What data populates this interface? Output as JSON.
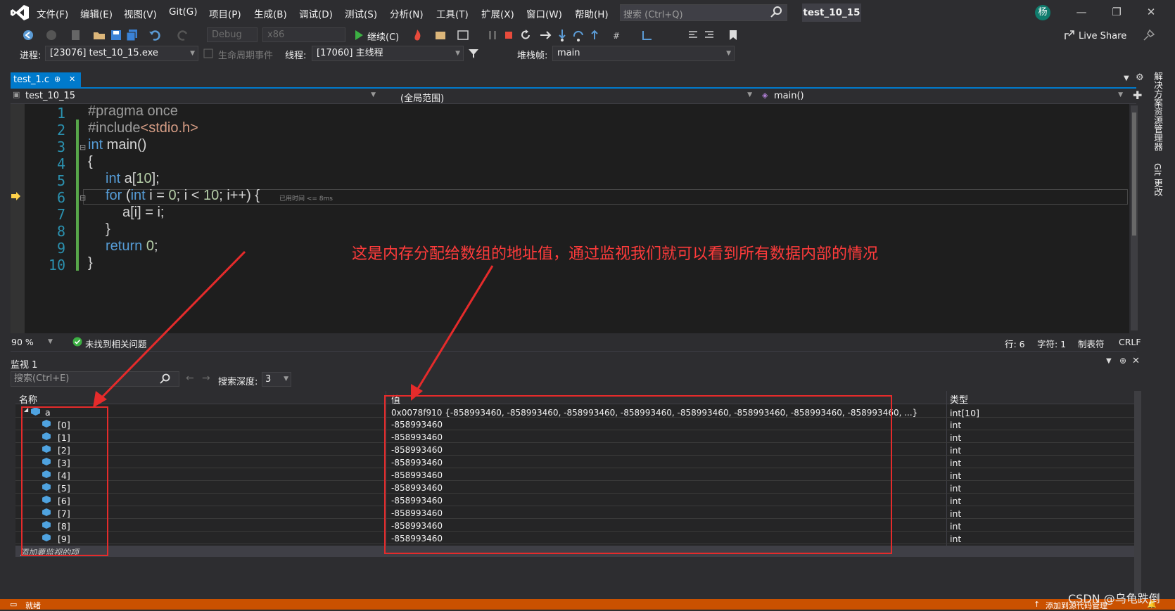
{
  "menu": [
    "文件(F)",
    "编辑(E)",
    "视图(V)",
    "Git(G)",
    "项目(P)",
    "生成(B)",
    "调试(D)",
    "测试(S)",
    "分析(N)",
    "工具(T)",
    "扩展(X)",
    "窗口(W)",
    "帮助(H)"
  ],
  "search_placeholder": "搜索 (Ctrl+Q)",
  "solution_title": "test_10_15",
  "avatar_initial": "杨",
  "toolbar": {
    "config": "Debug",
    "platform": "x86",
    "continue_label": "继续(C)",
    "live_share": "Live Share"
  },
  "debug_location": {
    "process_label": "进程:",
    "process_value": "[23076] test_10_15.exe",
    "lifecycle_label": "生命周期事件",
    "thread_label": "线程:",
    "thread_value": "[17060] 主线程",
    "stackframe_label": "堆栈帧:",
    "stackframe_value": "main"
  },
  "editor": {
    "tab_label": "test_1.c",
    "tab_pin": "⊕",
    "tab_close": "✕",
    "project_combo": "test_10_15",
    "scope_combo": "(全局范围)",
    "member_combo": "main()",
    "line_numbers": [
      "1",
      "2",
      "3",
      "4",
      "5",
      "6",
      "7",
      "8",
      "9",
      "10"
    ],
    "elapsed_hint": "已用时间 <= 8ms",
    "annotation": "这是内存分配给数组的地址值，通过监视我们就可以看到所有数据内部的情况"
  },
  "ed_status": {
    "zoom": "90 %",
    "issues": "未找到相关问题",
    "line": "行: 6",
    "char": "字符: 1",
    "tabs": "制表符",
    "eol": "CRLF"
  },
  "watch": {
    "title": "监视 1",
    "search_placeholder": "搜索(Ctrl+E)",
    "depth_label": "搜索深度:",
    "depth_value": "3",
    "col_name": "名称",
    "col_value": "值",
    "col_type": "类型",
    "add_item": "添加要监视的项",
    "root": {
      "name": "a",
      "value": "0x0078f910 {-858993460, -858993460, -858993460, -858993460, -858993460, -858993460, -858993460, -858993460, ...}",
      "type": "int[10]"
    },
    "rows": [
      {
        "name": "[0]",
        "value": "-858993460",
        "type": "int"
      },
      {
        "name": "[1]",
        "value": "-858993460",
        "type": "int"
      },
      {
        "name": "[2]",
        "value": "-858993460",
        "type": "int"
      },
      {
        "name": "[3]",
        "value": "-858993460",
        "type": "int"
      },
      {
        "name": "[4]",
        "value": "-858993460",
        "type": "int"
      },
      {
        "name": "[5]",
        "value": "-858993460",
        "type": "int"
      },
      {
        "name": "[6]",
        "value": "-858993460",
        "type": "int"
      },
      {
        "name": "[7]",
        "value": "-858993460",
        "type": "int"
      },
      {
        "name": "[8]",
        "value": "-858993460",
        "type": "int"
      },
      {
        "name": "[9]",
        "value": "-858993460",
        "type": "int"
      }
    ]
  },
  "side_panels": [
    "解决方案资源管理器",
    "Git 更改"
  ],
  "status_left": "就绪",
  "status_right": "添加到源代码管理",
  "watermark": "CSDN @乌龟跌倒",
  "colors": {
    "accent": "#007acc",
    "status": "#ca5100",
    "annotation": "#e52b2b"
  }
}
